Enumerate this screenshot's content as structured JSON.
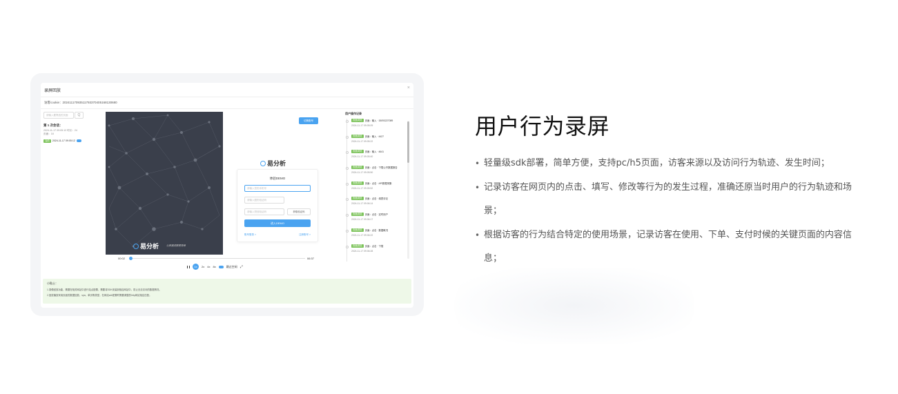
{
  "modal": {
    "title": "录屏回放",
    "close": "×",
    "cookie_text": "访客cookie：20241117093511793370405168130680"
  },
  "visit_panel": {
    "search_placeholder": "请输入要筛选的页面",
    "search_button": "Q",
    "heading": "第 1 次会话：",
    "meta_line1": "2024-11-17 09:05:12  时长：24",
    "meta_line2": "页面：18",
    "item_tag": "当前",
    "item_time": "2024-11-17 09:05:12"
  },
  "replay": {
    "brand": "易分析",
    "slogan": "让数据洞察更简单",
    "top_button": "切换账号",
    "login_logo": "易分析",
    "login_title": "体验DEMO",
    "phone_placeholder": "请输入您的手机号",
    "captcha_placeholder": "请输入图形验证码",
    "sms_placeholder": "请输入短信验证码",
    "sms_button": "获取验证码",
    "submit": "进入DEMO",
    "link_left": "账号登录 >",
    "link_right": "注册账号 >"
  },
  "playback": {
    "current_time": "00:02",
    "total_time": "06:37",
    "speeds": [
      "1x",
      "2x",
      "4x",
      "8x"
    ],
    "active_speed": "1x",
    "skip_label": "跳过空闲"
  },
  "records": {
    "title": "用户操作记录",
    "items": [
      {
        "tag": "页面浏览",
        "text": "页面：输入 · 15093227089",
        "time": "2024-11-17 09:05:09"
      },
      {
        "tag": "页面浏览",
        "text": "页面：输入 · 4427",
        "time": "2024-11-17 09:05:22"
      },
      {
        "tag": "页面浏览",
        "text": "页面：输入 · 4641",
        "time": "2024-11-17 09:05:40"
      },
      {
        "tag": "页面浏览",
        "text": "页面：点击 · 下载公开数据报告",
        "time": "2024-11-17 09:05:50"
      },
      {
        "tag": "页面浏览",
        "text": "页面：点击 · API数据采集",
        "time": "2024-11-17 09:05:52"
      },
      {
        "tag": "页面浏览",
        "text": "页面：点击 · 填表评论",
        "time": "2024-11-17 09:06:14"
      },
      {
        "tag": "页面浏览",
        "text": "页面：点击 · 定时用户",
        "time": "2024-11-17 09:06:17"
      },
      {
        "tag": "页面浏览",
        "text": "页面：点击 · 数据概况",
        "time": "2024-11-17 09:06:22"
      },
      {
        "tag": "页面浏览",
        "text": "页面：点击 · 下载",
        "time": "2024-11-17 09:06:28"
      }
    ]
  },
  "tips": {
    "title": "小贴士：",
    "line1": "1.录像回放功能，需要在相关网站中进行站点配置，需要将SDK安装到相应网站中，防止无法访问的数据情况。",
    "line2": "2.回放播放采用页面的数据回放，spa、单页等类型，在网站sdk配置时需要调整的http网站相应匹配。"
  },
  "feature": {
    "title": "用户行为录屏",
    "bullets": [
      "轻量级sdk部署，简单方便，支持pc/h5页面，访客来源以及访问行为轨迹、发生时间；",
      "记录访客在网页内的点击、填写、修改等行为的发生过程，准确还原当时用户的行为轨迹和场景；",
      "根据访客的行为结合特定的使用场景，记录访客在使用、下单、支付时候的关键页面的内容信息；"
    ]
  },
  "colors": {
    "accent": "#4aa3f0",
    "tag_green": "#7cc35a",
    "replay_bg": "#3a3f4b",
    "tips_bg": "#eef8e8"
  }
}
